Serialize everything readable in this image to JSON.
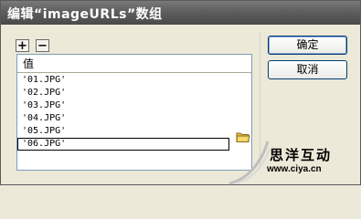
{
  "window": {
    "title": "编辑“imageURLs”数组"
  },
  "toolbar": {
    "add_label": "+",
    "remove_label": "−"
  },
  "grid": {
    "column_header": "值",
    "rows": [
      "'01.JPG'",
      "'02.JPG'",
      "'03.JPG'",
      "'04.JPG'",
      "'05.JPG'",
      "'06.JPG'"
    ],
    "selected_index": 5
  },
  "buttons": {
    "ok_label": "确定",
    "cancel_label": "取消"
  },
  "watermark": {
    "title": "思洋互动",
    "url": "www.ciya.cn"
  },
  "icons": {
    "add": "plus-icon",
    "remove": "minus-icon",
    "browse": "folder-icon"
  }
}
